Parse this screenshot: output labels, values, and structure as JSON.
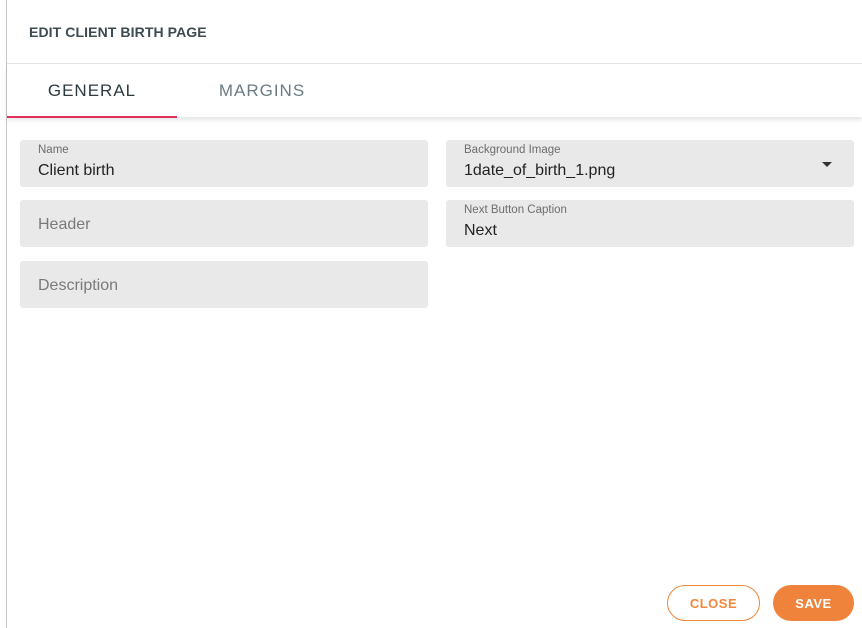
{
  "dialog": {
    "title": "EDIT CLIENT BIRTH PAGE"
  },
  "tabs": [
    {
      "label": "GENERAL",
      "active": true
    },
    {
      "label": "MARGINS",
      "active": false
    }
  ],
  "form": {
    "name": {
      "label": "Name",
      "value": "Client birth"
    },
    "header": {
      "placeholder": "Header"
    },
    "description": {
      "placeholder": "Description"
    },
    "background_image": {
      "label": "Background Image",
      "value": "1date_of_birth_1.png"
    },
    "next_button_caption": {
      "label": "Next Button Caption",
      "value": "Next"
    }
  },
  "actions": {
    "close_label": "CLOSE",
    "save_label": "SAVE"
  },
  "colors": {
    "accent": "#f0833c",
    "tab_indicator": "#e0305a",
    "field_bg": "#e9e9e9"
  }
}
